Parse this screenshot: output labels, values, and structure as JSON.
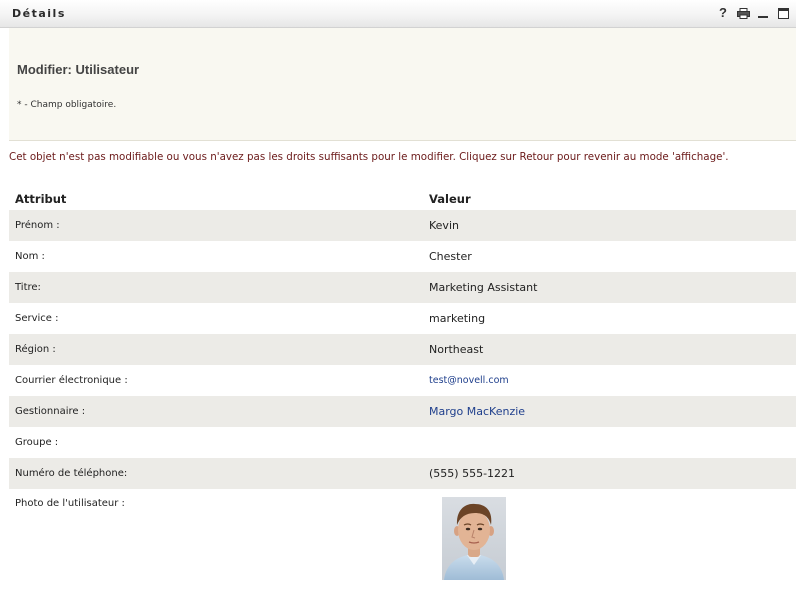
{
  "portlet": {
    "title": "Détails",
    "controls": [
      "help-icon",
      "print-icon",
      "minimize-icon",
      "maximize-icon"
    ],
    "help_label": "?"
  },
  "header": {
    "heading": "Modifier: Utilisateur",
    "required_note": "* - Champ obligatoire."
  },
  "warning": "Cet objet n'est pas modifiable ou vous n'avez pas les droits suffisants pour le modifier. Cliquez sur Retour pour revenir au mode 'affichage'.",
  "table": {
    "columns": [
      "Attribut",
      "Valeur"
    ],
    "rows": [
      {
        "attribute": "Prénom :",
        "value": "Kevin"
      },
      {
        "attribute": "Nom :",
        "value": "Chester"
      },
      {
        "attribute": "Titre:",
        "value": "Marketing Assistant"
      },
      {
        "attribute": "Service :",
        "value": "marketing"
      },
      {
        "attribute": "Région :",
        "value": "Northeast"
      },
      {
        "attribute": "Courrier électronique :",
        "value": "test@novell.com"
      },
      {
        "attribute": "Gestionnaire :",
        "value": "Margo MacKenzie"
      },
      {
        "attribute": "Groupe :",
        "value": ""
      },
      {
        "attribute": "Numéro de téléphone:",
        "value": "(555) 555-1221"
      },
      {
        "attribute": "Photo de l'utilisateur :",
        "value": ""
      }
    ]
  },
  "colors": {
    "warning_text": "#6b1a1a",
    "link": "#1f3f8c",
    "header_panel": "#f9f8f1",
    "row_shade": "#ecebe7"
  }
}
